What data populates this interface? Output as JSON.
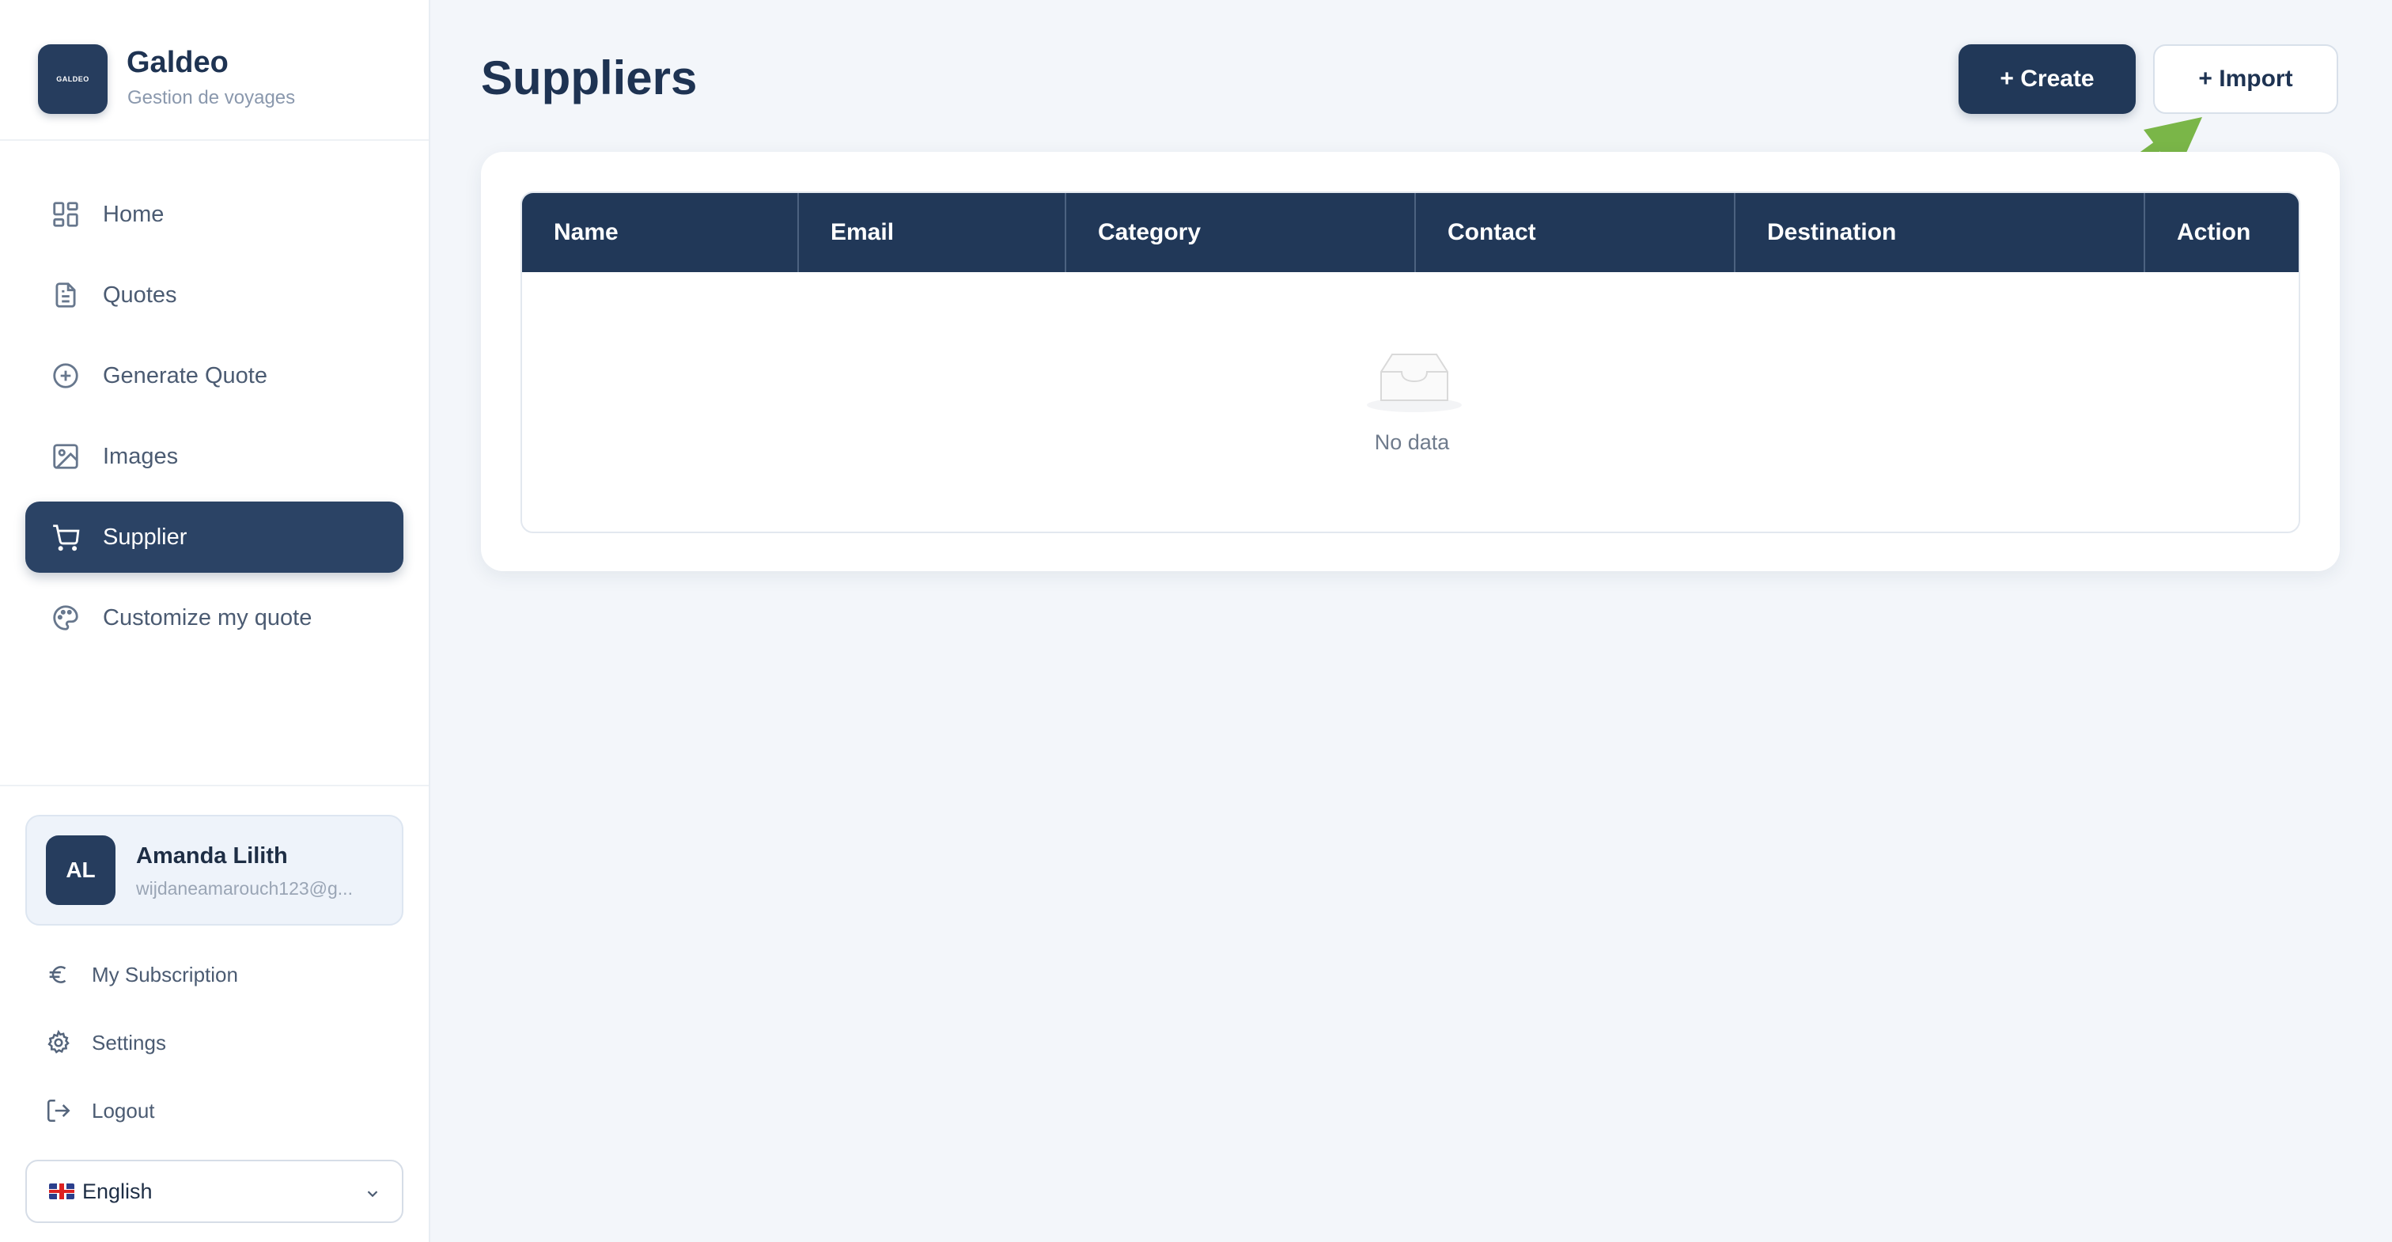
{
  "brand": {
    "logo_text": "GALDEO",
    "name": "Galdeo",
    "subtitle": "Gestion de voyages"
  },
  "sidebar": {
    "items": [
      {
        "label": "Home",
        "icon": "grid-icon",
        "active": false
      },
      {
        "label": "Quotes",
        "icon": "document-icon",
        "active": false
      },
      {
        "label": "Generate Quote",
        "icon": "plus-circle-icon",
        "active": false
      },
      {
        "label": "Images",
        "icon": "image-icon",
        "active": false
      },
      {
        "label": "Supplier",
        "icon": "cart-icon",
        "active": true
      },
      {
        "label": "Customize my quote",
        "icon": "palette-icon",
        "active": false
      }
    ]
  },
  "user": {
    "initials": "AL",
    "name": "Amanda Lilith",
    "email": "wijdaneamarouch123@g..."
  },
  "bottom_links": [
    {
      "label": "My Subscription",
      "icon": "euro-icon"
    },
    {
      "label": "Settings",
      "icon": "gear-icon"
    },
    {
      "label": "Logout",
      "icon": "logout-icon"
    }
  ],
  "language": {
    "selected": "English",
    "flag_icon": "uk-flag-icon"
  },
  "page": {
    "title": "Suppliers",
    "create_label": "+ Create",
    "import_label": "+ Import"
  },
  "table": {
    "columns": [
      "Name",
      "Email",
      "Category",
      "Contact",
      "Destination",
      "Action"
    ],
    "rows": [],
    "empty_text": "No data"
  },
  "colors": {
    "primary": "#213858",
    "sidebar_active": "#2b4365",
    "background": "#f3f6fa",
    "annotation_arrow": "#7ab648"
  }
}
